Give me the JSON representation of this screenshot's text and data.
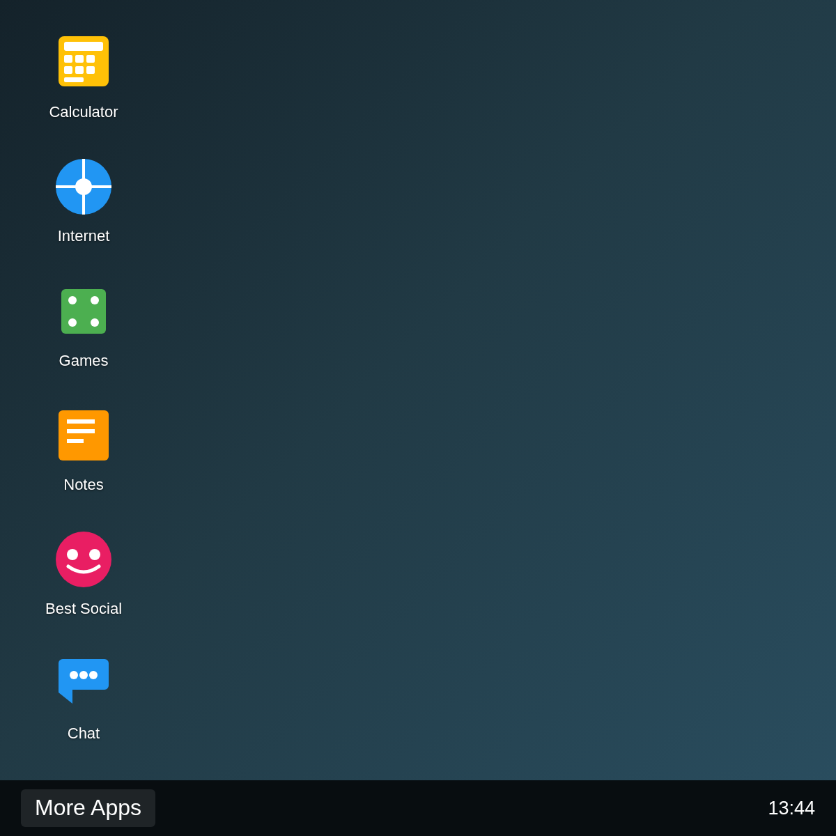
{
  "desktop": {
    "apps": [
      {
        "kind": "calculator",
        "label": "Calculator"
      },
      {
        "kind": "compass",
        "label": "Internet"
      },
      {
        "kind": "dice",
        "label": "Games"
      },
      {
        "kind": "notes",
        "label": "Notes"
      },
      {
        "kind": "smiley",
        "label": "Best Social"
      },
      {
        "kind": "chat",
        "label": "Chat"
      }
    ]
  },
  "taskbar": {
    "start_button": "More Apps",
    "clock": "13:44"
  }
}
